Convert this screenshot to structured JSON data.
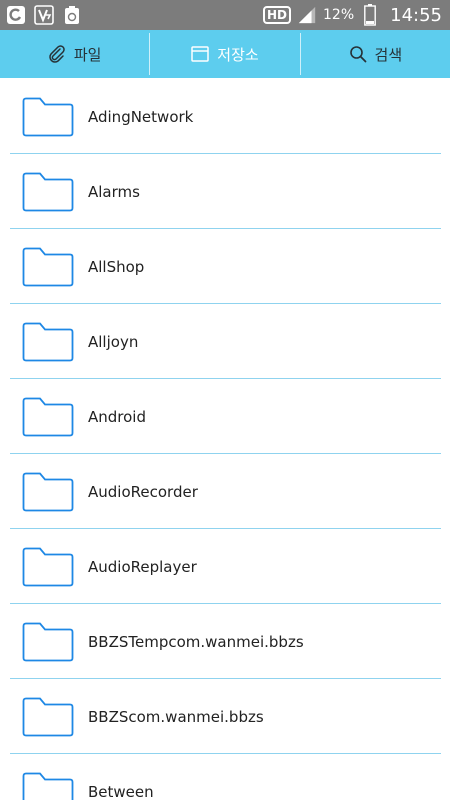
{
  "status_bar": {
    "hd_label": "HD",
    "battery_percent": "12%",
    "time": "14:55",
    "icons": [
      "carrier-logo-icon",
      "network-speed-icon",
      "recycle-icon",
      "signal-icon",
      "battery-icon"
    ]
  },
  "tabs": [
    {
      "label": "파일",
      "icon": "paperclip-icon",
      "active": false
    },
    {
      "label": "저장소",
      "icon": "window-icon",
      "active": true
    },
    {
      "label": "검색",
      "icon": "search-icon",
      "active": false
    }
  ],
  "folders": [
    {
      "name": "AdingNetwork"
    },
    {
      "name": "Alarms"
    },
    {
      "name": "AllShop"
    },
    {
      "name": "Alljoyn"
    },
    {
      "name": "Android"
    },
    {
      "name": "AudioRecorder"
    },
    {
      "name": "AudioReplayer"
    },
    {
      "name": "BBZSTempcom.wanmei.bbzs"
    },
    {
      "name": "BBZScom.wanmei.bbzs"
    },
    {
      "name": "Between"
    }
  ],
  "colors": {
    "accent": "#5dcdee",
    "folder_stroke": "#1e88e5",
    "divider": "#8fd3ef",
    "status_bar": "#7c7c7c"
  }
}
